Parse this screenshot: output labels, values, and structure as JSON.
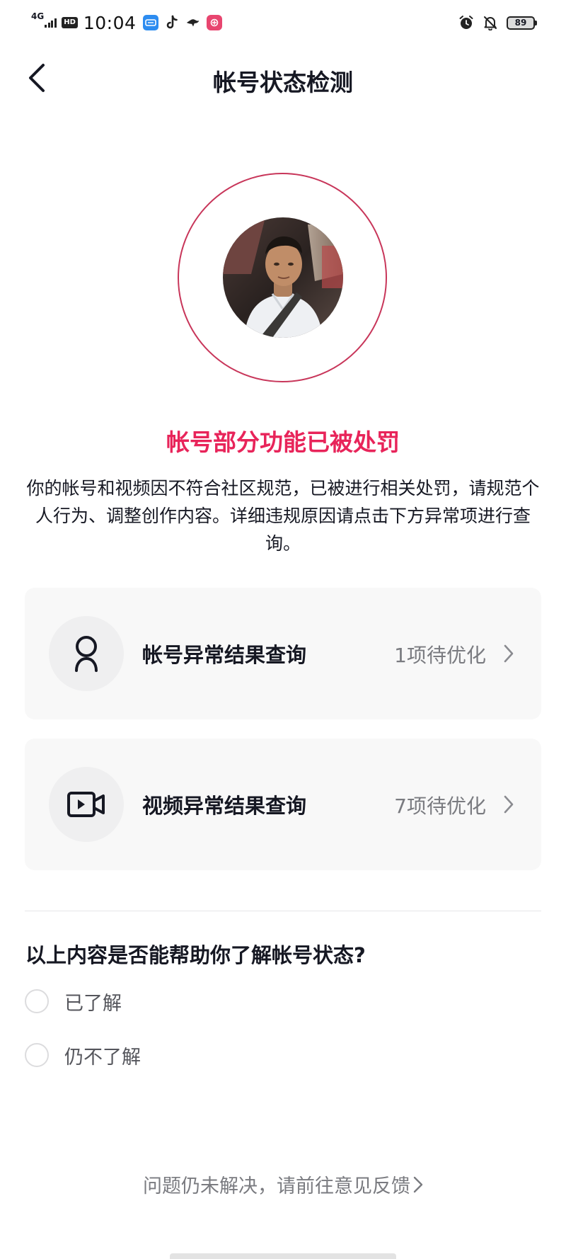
{
  "status_bar": {
    "network": "4G",
    "hd": "HD",
    "time": "10:04",
    "battery": "89",
    "icons": [
      "app-badge-icon",
      "tiktok-icon",
      "bird-icon",
      "app-red-icon",
      "alarm-icon",
      "bell-off-icon",
      "battery-icon"
    ]
  },
  "nav": {
    "title": "帐号状态检测",
    "back_icon": "chevron-left-icon"
  },
  "status": {
    "headline": "帐号部分功能已被处罚",
    "description": "你的帐号和视频因不符合社区规范，已被进行相关处罚，请规范个人行为、调整创作内容。详细违规原因请点击下方异常项进行查询。"
  },
  "cards": [
    {
      "icon": "user-icon",
      "label": "帐号异常结果查询",
      "count": "1项待优化"
    },
    {
      "icon": "video-camera-icon",
      "label": "视频异常结果查询",
      "count": "7项待优化"
    }
  ],
  "survey": {
    "question": "以上内容是否能帮助你了解帐号状态?",
    "options": [
      {
        "label": "已了解"
      },
      {
        "label": "仍不了解"
      }
    ]
  },
  "feedback": {
    "text": "问题仍未解决，请前往意见反馈"
  },
  "colors": {
    "accent": "#e8245a",
    "ring": "#c8365a",
    "card_bg": "#f8f8f8",
    "secondary_text": "#7a7b80"
  }
}
